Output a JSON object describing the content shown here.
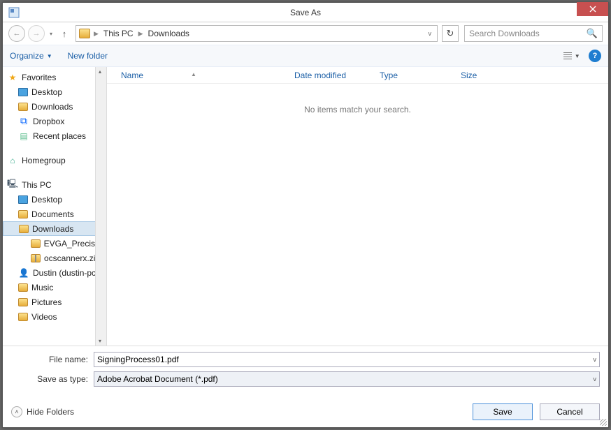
{
  "window": {
    "title": "Save As"
  },
  "nav": {
    "breadcrumbs": [
      "This PC",
      "Downloads"
    ],
    "search_placeholder": "Search Downloads"
  },
  "toolbar": {
    "organize": "Organize",
    "newfolder": "New folder"
  },
  "sidebar": {
    "favorites_label": "Favorites",
    "favorites": [
      "Desktop",
      "Downloads",
      "Dropbox",
      "Recent places"
    ],
    "homegroup": "Homegroup",
    "thispc_label": "This PC",
    "thispc": [
      "Desktop",
      "Documents",
      "Downloads",
      "EVGA_Precision",
      "ocscannerx.zip",
      "Dustin (dustin-pc",
      "Music",
      "Pictures",
      "Videos"
    ]
  },
  "columns": {
    "name": "Name",
    "date": "Date modified",
    "type": "Type",
    "size": "Size"
  },
  "list": {
    "empty_msg": "No items match your search."
  },
  "form": {
    "filename_label": "File name:",
    "filename_value": "SigningProcess01.pdf",
    "savetype_label": "Save as type:",
    "savetype_value": "Adobe Acrobat Document (*.pdf)"
  },
  "footer": {
    "hidefolders": "Hide Folders",
    "save": "Save",
    "cancel": "Cancel"
  }
}
